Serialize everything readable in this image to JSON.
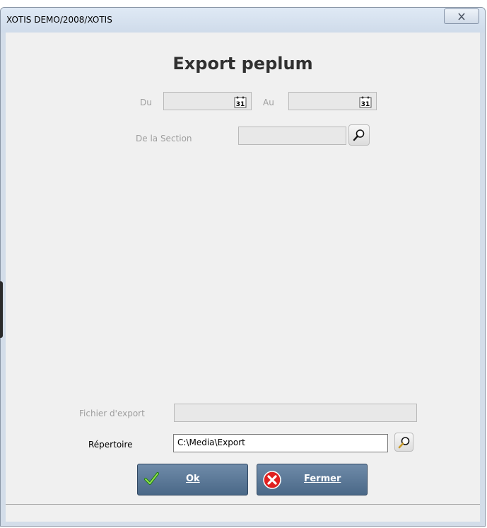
{
  "window": {
    "title": "XOTIS DEMO/2008/XOTIS"
  },
  "form": {
    "heading": "Export peplum",
    "du_label": "Du",
    "au_label": "Au",
    "calendar_day": "31",
    "section_label": "De la Section",
    "fichier_label": "Fichier d'export",
    "repertoire_label": "Répertoire",
    "repertoire_value": "C:\\Media\\Export"
  },
  "buttons": {
    "ok_label": "Ok",
    "fermer_label": "Fermer"
  },
  "icons": {
    "calendar": "calendar-icon",
    "search": "magnifier-icon",
    "ok": "green-check-icon",
    "fermer": "red-x-circle-icon",
    "close": "close-x-icon"
  }
}
